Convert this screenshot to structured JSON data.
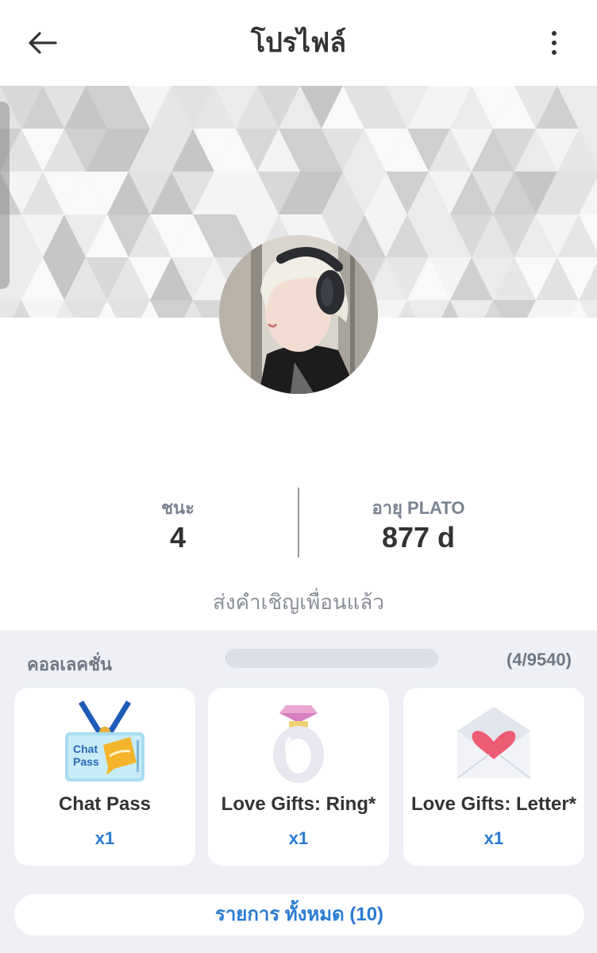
{
  "header": {
    "title": "โปรไฟล์",
    "back_icon": "arrow-left-icon",
    "more_icon": "more-vertical-icon"
  },
  "profile": {
    "cover_pattern": "gray-triangle-mosaic",
    "avatar_alt": "profile-photo"
  },
  "stats": {
    "wins_label": "ชนะ",
    "wins_value": "4",
    "age_label": "อายุ PLATO",
    "age_value": "877 d"
  },
  "invite_status": "ส่งคำเชิญเพื่อนแล้ว",
  "collection": {
    "title": "คอลเลคชั่น",
    "count": "(4/9540)",
    "progress_fraction": 0.0004,
    "items": [
      {
        "name": "Chat Pass",
        "qty": "x1",
        "icon": "chat-pass-ticket-icon"
      },
      {
        "name": "Love Gifts: Ring*",
        "qty": "x1",
        "icon": "diamond-ring-icon"
      },
      {
        "name": "Love Gifts: Letter*",
        "qty": "x1",
        "icon": "heart-letter-icon"
      }
    ],
    "all_button": "รายการ ทั้งหมด (10)"
  },
  "colors": {
    "accent_blue": "#2a7bd3",
    "panel_bg": "#eef0f5",
    "muted_text": "#7a8290"
  }
}
